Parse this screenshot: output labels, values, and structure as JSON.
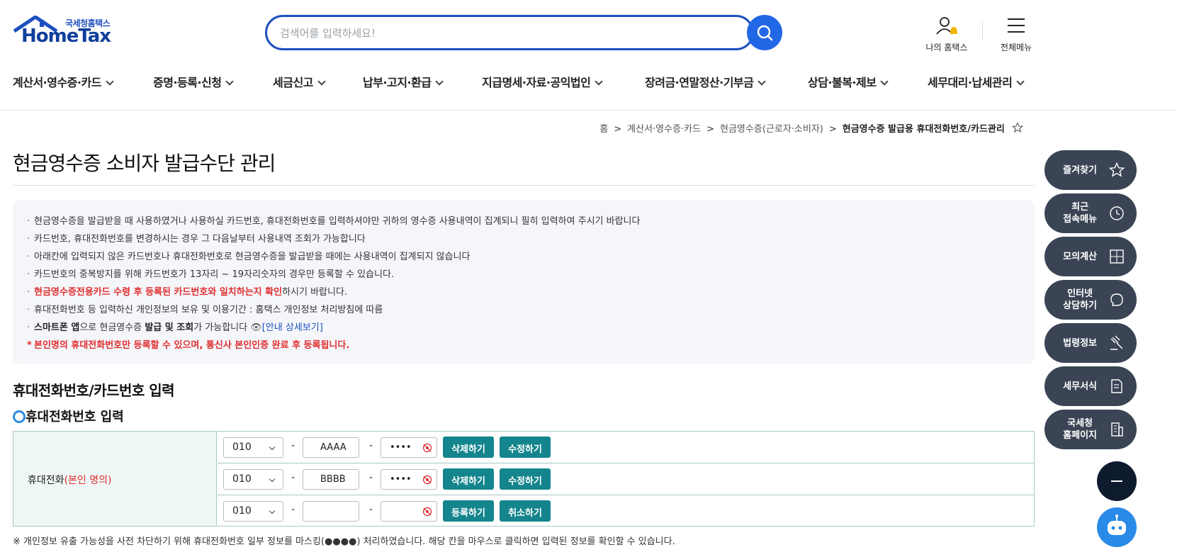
{
  "header": {
    "logo_small": "국세청홈택스",
    "logo_big": "HomeTax",
    "search_placeholder": "검색어를 입력하세요!",
    "my_hometax": "나의 홈택스",
    "all_menu": "전체메뉴"
  },
  "gnb": [
    "계산서·영수증·카드",
    "증명·등록·신청",
    "세금신고",
    "납부·고지·환급",
    "지급명세·자료·공익법인",
    "장려금·연말정산·기부금",
    "상담·불복·제보",
    "세무대리·납세관리"
  ],
  "breadcrumb": [
    "홈",
    "계산서·영수증·카드",
    "현금영수증(근로자·소비자)",
    "현금영수증 발급용 휴대전화번호/카드관리"
  ],
  "page_title": "현금영수증 소비자 발급수단 관리",
  "notice": {
    "l1": "현금영수증을 발급받을 때 사용하였거나 사용하실 카드번호, 휴대전화번호를 입력하셔야만 귀하의 영수증 사용내역이 집계되니 필히 입력하여 주시기 바랍니다",
    "l2": "카드번호, 휴대전화번호를 변경하시는 경우 그 다음날부터 사용내역 조회가 가능합니다",
    "l3": "아래칸에 입력되지 않은 카드번호나 휴대전화번호로 현금영수증을 발급받을 때에는 사용내역이 집계되지 않습니다",
    "l4": "카드번호의 중복방지를 위해 카드번호가 13자리 ~ 19자리숫자의 경우만 등록할 수 있습니다.",
    "l5_red": "현금영수증전용카드 수령 후 등록된 카드번호와 일치하는지 확인",
    "l5_rest": "하시기 바랍니다.",
    "l6": "휴대전화번호 등 입력하신 개인정보의 보유 및 이용기간 : 홈택스 개인정보 처리방침에 따름",
    "l7_b1": "스마트폰 앱",
    "l7_t1": "으로 현금영수증 ",
    "l7_b2": "발급 및 조회",
    "l7_t2": "가 가능합니다 ",
    "l7_link": "[안내 상세보기]",
    "l8": "본인명의 휴대전화번호만 등록할 수 있으며, 통신사 본인인증 완료 후 등록됩니다."
  },
  "section_title": "휴대전화번호/카드번호 입력",
  "sub_title": "휴대전화번호 입력",
  "phone_table": {
    "label": "휴대전화",
    "label_red": "(본인 명의)",
    "rows": [
      {
        "prefix": "010",
        "mid": "AAAA",
        "last": "••••",
        "btn1": "삭제하기",
        "btn2": "수정하기"
      },
      {
        "prefix": "010",
        "mid": "BBBB",
        "last": "••••",
        "btn1": "삭제하기",
        "btn2": "수정하기"
      },
      {
        "prefix": "010",
        "mid": "",
        "last": "",
        "btn1": "등록하기",
        "btn2": "취소하기"
      }
    ],
    "dash": "-"
  },
  "foot_note": "※ 개인정보 유출 가능성을 사전 차단하기 위해 휴대전화번호 일부 정보를 마스킹(●●●●) 처리하였습니다. 해당 칸을 마우스로 클릭하면 입력된 정보를 확인할 수 있습니다.",
  "side_menu": [
    {
      "label": "즐겨찾기",
      "icon": "star-icon"
    },
    {
      "label": "최근\n접속메뉴",
      "icon": "clock-icon"
    },
    {
      "label": "모의계산",
      "icon": "calculator-icon"
    },
    {
      "label": "인터넷\n상담하기",
      "icon": "chat-icon"
    },
    {
      "label": "법령정보",
      "icon": "gavel-icon"
    },
    {
      "label": "세무서식",
      "icon": "document-icon"
    },
    {
      "label": "국세청\n홈페이지",
      "icon": "building-icon"
    }
  ],
  "colors": {
    "brand": "#1d4fbf",
    "teal_button": "#14858d",
    "side_button": "#3a4454",
    "red": "#e02d2d"
  }
}
